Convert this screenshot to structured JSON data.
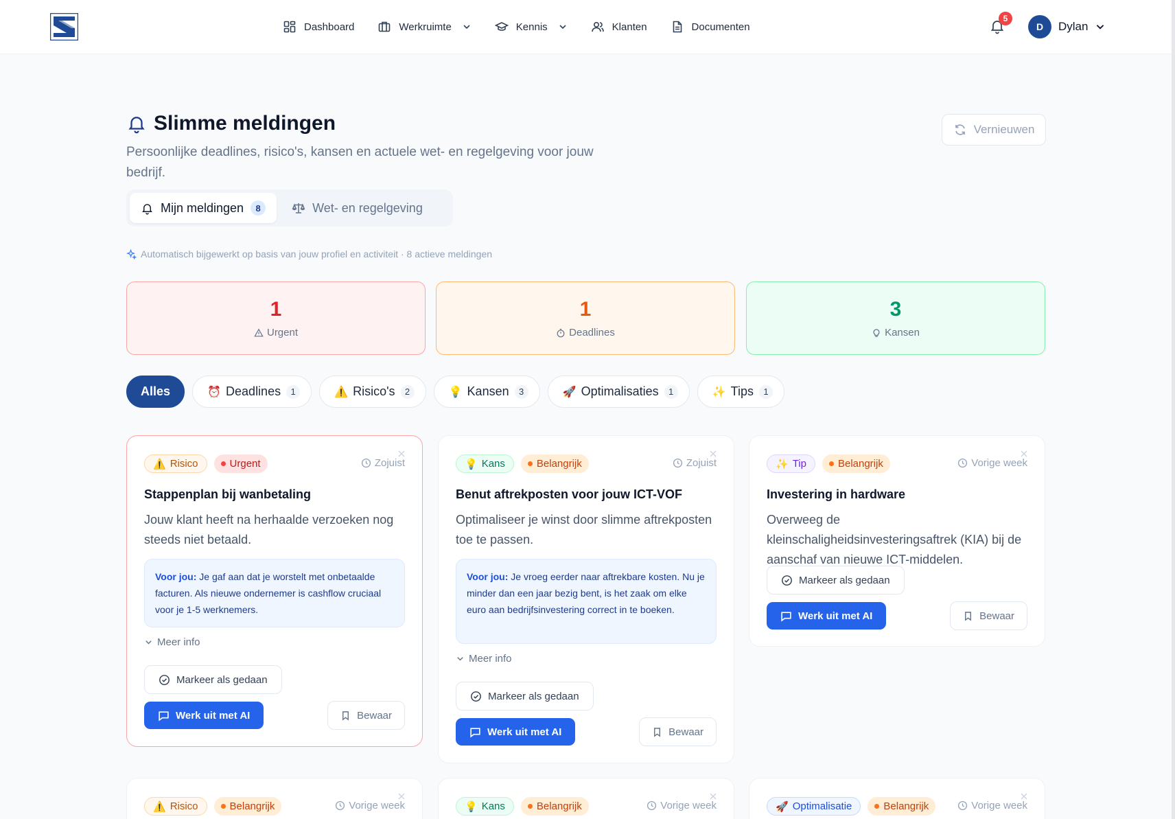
{
  "nav": {
    "items": [
      {
        "label": "Dashboard",
        "icon": "grid-icon",
        "dropdown": false
      },
      {
        "label": "Werkruimte",
        "icon": "briefcase-icon",
        "dropdown": true
      },
      {
        "label": "Kennis",
        "icon": "graduation-cap-icon",
        "dropdown": true
      },
      {
        "label": "Klanten",
        "icon": "users-icon",
        "dropdown": false
      },
      {
        "label": "Documenten",
        "icon": "document-icon",
        "dropdown": false
      }
    ],
    "notifications_count": "5",
    "user_initial": "D",
    "user_name": "Dylan"
  },
  "header": {
    "title": "Slimme meldingen",
    "subtitle": "Persoonlijke deadlines, risico's, kansen en actuele wet- en regelgeving voor jouw bedrijf.",
    "refresh_label": "Vernieuwen"
  },
  "tabs": [
    {
      "label": "Mijn meldingen",
      "count": "8",
      "active": true
    },
    {
      "label": "Wet- en regelgeving",
      "count": "",
      "active": false
    }
  ],
  "auto_note": "Automatisch bijgewerkt op basis van jouw profiel en activiteit · 8 actieve meldingen",
  "stats": [
    {
      "value": "1",
      "label": "Urgent"
    },
    {
      "value": "1",
      "label": "Deadlines"
    },
    {
      "value": "3",
      "label": "Kansen"
    }
  ],
  "filters": [
    {
      "label": "Alles",
      "emoji": "",
      "count": ""
    },
    {
      "label": "Deadlines",
      "emoji": "⏰",
      "count": "1"
    },
    {
      "label": "Risico's",
      "emoji": "⚠️",
      "count": "2"
    },
    {
      "label": "Kansen",
      "emoji": "💡",
      "count": "3"
    },
    {
      "label": "Optimalisaties",
      "emoji": "🚀",
      "count": "1"
    },
    {
      "label": "Tips",
      "emoji": "✨",
      "count": "1"
    }
  ],
  "card_labels": {
    "for_you": "Voor jou:",
    "more_info": "Meer info",
    "mark_done": "Markeer als gedaan",
    "work_ai": "Werk uit met AI",
    "save": "Bewaar"
  },
  "cards": [
    {
      "type": "Risico",
      "type_emoji": "⚠️",
      "priority": "Urgent",
      "time": "Zojuist",
      "title": "Stappenplan bij wanbetaling",
      "description": "Jouw klant heeft na herhaalde verzoeken nog steeds niet betaald.",
      "for_you": "Je gaf aan dat je worstelt met onbetaalde facturen. Als nieuwe ondernemer is cashflow cruciaal voor je 1-5 werknemers."
    },
    {
      "type": "Kans",
      "type_emoji": "💡",
      "priority": "Belangrijk",
      "time": "Zojuist",
      "title": "Benut aftrekposten voor jouw ICT-VOF",
      "description": "Optimaliseer je winst door slimme aftrekposten toe te passen.",
      "for_you": "Je vroeg eerder naar aftrekbare kosten. Nu je minder dan een jaar bezig bent, is het zaak om elke euro aan bedrijfsinvestering correct in te boeken."
    },
    {
      "type": "Tip",
      "type_emoji": "✨",
      "priority": "Belangrijk",
      "time": "Vorige week",
      "title": "Investering in hardware",
      "description": "Overweeg de kleinschaligheidsinvesteringsaftrek (KIA) bij de aanschaf van nieuwe ICT-middelen."
    },
    {
      "type": "Risico",
      "type_emoji": "⚠️",
      "priority": "Belangrijk",
      "time": "Vorige week"
    },
    {
      "type": "Kans",
      "type_emoji": "💡",
      "priority": "Belangrijk",
      "time": "Vorige week"
    },
    {
      "type": "Optimalisatie",
      "type_emoji": "🚀",
      "priority": "Belangrijk",
      "time": "Vorige week"
    }
  ]
}
